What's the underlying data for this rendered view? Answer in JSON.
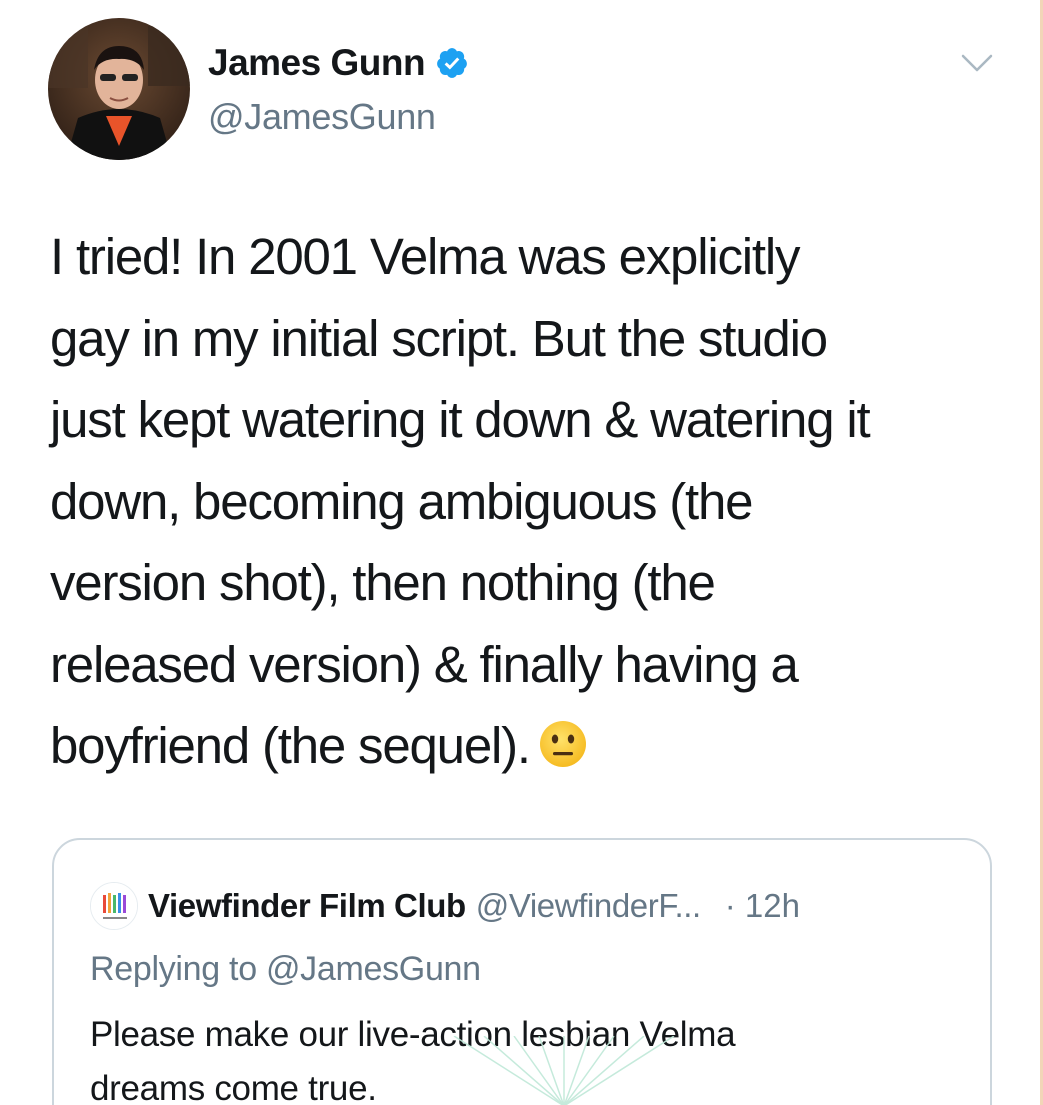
{
  "author": {
    "display_name": "James Gunn",
    "handle": "@JamesGunn",
    "verified": true
  },
  "tweet": {
    "text": "I tried! In 2001 Velma was explicitly\ngay in my initial script. But the studio\njust kept watering it down & watering it\ndown, becoming ambiguous (the\nversion shot), then nothing (the\nreleased version) & finally having a\nboyfriend (the sequel).",
    "emoji": "neutral-face"
  },
  "quoted_tweet": {
    "display_name": "Viewfinder Film Club",
    "handle": "@ViewfinderF...",
    "time": "· 12h",
    "replying_to": "Replying to @JamesGunn",
    "text": "Please make our live-action lesbian Velma\ndreams come true."
  },
  "colors": {
    "text_primary": "#14171a",
    "text_secondary": "#657786",
    "verified_blue": "#1da1f2",
    "border": "#ccd6dd"
  }
}
